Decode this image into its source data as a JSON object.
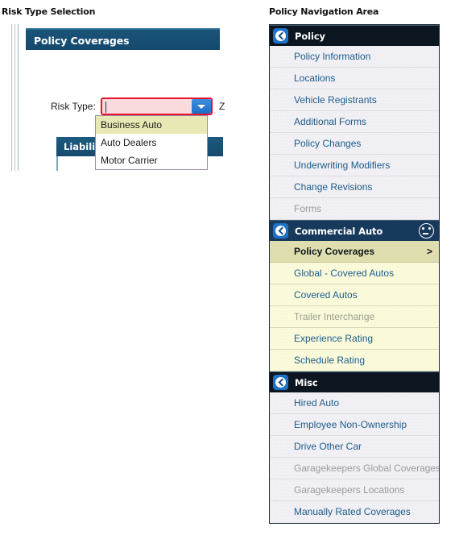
{
  "captions": {
    "left": "Risk Type Selection",
    "right": "Policy Navigation Area"
  },
  "left_panel": {
    "card_header": "Policy Coverages",
    "risk_type_label": "Risk Type:",
    "risk_type_value": "",
    "trailing_text": "Z",
    "dropdown_options": [
      {
        "label": "Business Auto",
        "selected": true
      },
      {
        "label": "Auto Dealers",
        "selected": false
      },
      {
        "label": "Motor Carrier",
        "selected": false
      }
    ],
    "liability_tab": "Liability",
    "colors": {
      "header_blue": "#14496d",
      "error_red": "#e8102a",
      "error_fill": "#fadbdd",
      "arrow_blue": "#1d6fc4",
      "option_highlight": "#e8e8b4"
    }
  },
  "nav_panel": {
    "groups": [
      {
        "title": "Policy",
        "icon": "chevron-badge-icon",
        "header_style": "dark",
        "status_icon": null,
        "items": [
          {
            "label": "Policy Information",
            "state": "normal"
          },
          {
            "label": "Locations",
            "state": "normal"
          },
          {
            "label": "Vehicle Registrants",
            "state": "normal"
          },
          {
            "label": "Additional Forms",
            "state": "normal"
          },
          {
            "label": "Policy Changes",
            "state": "normal"
          },
          {
            "label": "Underwriting Modifiers",
            "state": "normal"
          },
          {
            "label": "Change Revisions",
            "state": "normal"
          },
          {
            "label": "Forms",
            "state": "disabled"
          }
        ]
      },
      {
        "title": "Commercial Auto",
        "icon": "chevron-badge-icon",
        "header_style": "navy",
        "status_icon": "neutral-face-icon",
        "items": [
          {
            "label": "Policy Coverages",
            "state": "selected",
            "chevron": ">"
          },
          {
            "label": "Global - Covered Autos",
            "state": "yellow"
          },
          {
            "label": "Covered Autos",
            "state": "yellow"
          },
          {
            "label": "Trailer Interchange",
            "state": "yellow-disabled"
          },
          {
            "label": "Experience Rating",
            "state": "yellow"
          },
          {
            "label": "Schedule Rating",
            "state": "yellow"
          }
        ]
      },
      {
        "title": "Misc",
        "icon": "chevron-badge-icon",
        "header_style": "dark",
        "status_icon": null,
        "items": [
          {
            "label": "Hired Auto",
            "state": "normal"
          },
          {
            "label": "Employee Non-Ownership",
            "state": "normal"
          },
          {
            "label": "Drive Other Car",
            "state": "normal"
          },
          {
            "label": "Garagekeepers Global Coverages",
            "state": "disabled"
          },
          {
            "label": "Garagekeepers Locations",
            "state": "disabled"
          },
          {
            "label": "Manually Rated Coverages",
            "state": "normal"
          }
        ]
      }
    ],
    "colors": {
      "header_dark": "#0b1620",
      "header_navy": "#173a5c",
      "link_blue": "#1c5c8a",
      "disabled_gray": "#9a9a9f",
      "yellow_row": "#fbfbdc",
      "selected_row": "#dedeae"
    }
  }
}
